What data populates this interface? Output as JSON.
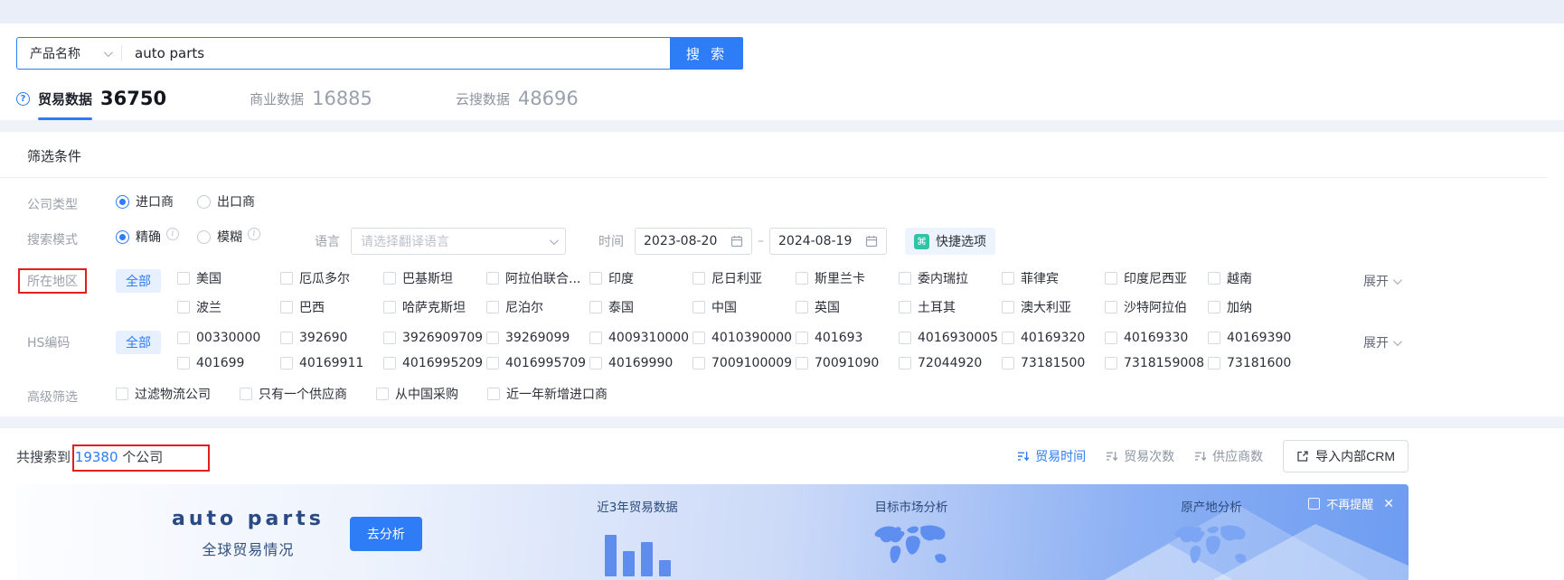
{
  "colors": {
    "primary": "#2e7cf6",
    "annotation_red": "#e11f1f",
    "quick_icon_teal": "#2fc3a7"
  },
  "search": {
    "category": "产品名称",
    "query": "auto parts",
    "button": "搜 索"
  },
  "tabs": [
    {
      "label": "贸易数据",
      "count": "36750"
    },
    {
      "label": "商业数据",
      "count": "16885"
    },
    {
      "label": "云搜数据",
      "count": "48696"
    }
  ],
  "filter": {
    "title": "筛选条件",
    "company_type": {
      "label": "公司类型",
      "options": [
        "进口商",
        "出口商"
      ]
    },
    "search_mode": {
      "label": "搜索模式",
      "options": [
        "精确",
        "模糊"
      ]
    },
    "language": {
      "label": "语言",
      "placeholder": "请选择翻译语言"
    },
    "time": {
      "label": "时间",
      "start": "2023-08-20",
      "separator": "–",
      "end": "2024-08-19"
    },
    "quick_option": "快捷选项",
    "quick_icon": "⌘",
    "region": {
      "label": "所在地区",
      "all": "全部",
      "expand": "展开",
      "items": [
        "美国",
        "厄瓜多尔",
        "巴基斯坦",
        "阿拉伯联合...",
        "印度",
        "尼日利亚",
        "斯里兰卡",
        "委内瑞拉",
        "菲律宾",
        "印度尼西亚",
        "越南",
        "波兰",
        "巴西",
        "哈萨克斯坦",
        "尼泊尔",
        "泰国",
        "中国",
        "英国",
        "土耳其",
        "澳大利亚",
        "沙特阿拉伯",
        "加纳"
      ]
    },
    "hs": {
      "label": "HS编码",
      "all": "全部",
      "expand": "展开",
      "items": [
        "00330000",
        "392690",
        "3926909709",
        "39269099",
        "4009310000",
        "4010390000",
        "401693",
        "4016930005",
        "40169320",
        "40169330",
        "40169390",
        "401699",
        "40169911",
        "4016995209",
        "4016995709",
        "40169990",
        "7009100009",
        "70091090",
        "72044920",
        "73181500",
        "7318159008",
        "73181600"
      ]
    },
    "advanced": {
      "label": "高级筛选",
      "items": [
        "过滤物流公司",
        "只有一个供应商",
        "从中国采购",
        "近一年新增进口商"
      ]
    }
  },
  "results": {
    "prefix": "共搜索到",
    "count": "19380",
    "suffix": "个公司",
    "sorts": [
      "贸易时间",
      "贸易次数",
      "供应商数"
    ],
    "crm_button": "导入内部CRM"
  },
  "banner": {
    "product": "auto parts",
    "subtitle": "全球贸易情况",
    "analyze": "去分析",
    "chart_title": "近3年贸易数据",
    "market_title": "目标市场分析",
    "origin_title": "原产地分析",
    "dismiss": "不再提醒",
    "close": "✕"
  }
}
